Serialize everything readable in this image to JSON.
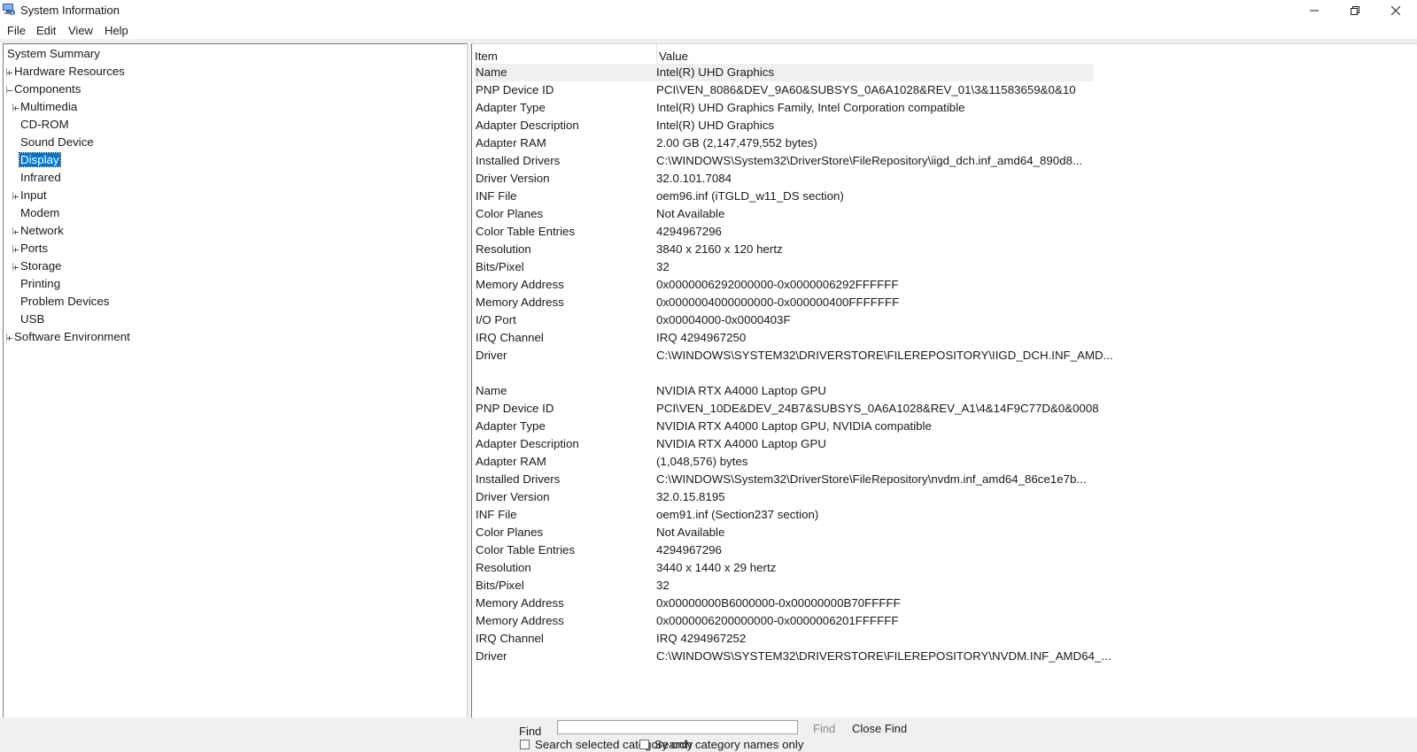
{
  "window": {
    "title": "System Information"
  },
  "menu": [
    "File",
    "Edit",
    "View",
    "Help"
  ],
  "tree": [
    {
      "label": "System Summary",
      "level": 0,
      "expander": "none"
    },
    {
      "label": "Hardware Resources",
      "level": 1,
      "expander": "plus"
    },
    {
      "label": "Components",
      "level": 1,
      "expander": "minus"
    },
    {
      "label": "Multimedia",
      "level": 2,
      "expander": "plus"
    },
    {
      "label": "CD-ROM",
      "level": 2,
      "expander": "none"
    },
    {
      "label": "Sound Device",
      "level": 2,
      "expander": "none"
    },
    {
      "label": "Display",
      "level": 2,
      "expander": "none",
      "selected": true
    },
    {
      "label": "Infrared",
      "level": 2,
      "expander": "none"
    },
    {
      "label": "Input",
      "level": 2,
      "expander": "plus"
    },
    {
      "label": "Modem",
      "level": 2,
      "expander": "none"
    },
    {
      "label": "Network",
      "level": 2,
      "expander": "plus"
    },
    {
      "label": "Ports",
      "level": 2,
      "expander": "plus"
    },
    {
      "label": "Storage",
      "level": 2,
      "expander": "plus"
    },
    {
      "label": "Printing",
      "level": 2,
      "expander": "none"
    },
    {
      "label": "Problem Devices",
      "level": 2,
      "expander": "none"
    },
    {
      "label": "USB",
      "level": 2,
      "expander": "none"
    },
    {
      "label": "Software Environment",
      "level": 1,
      "expander": "plus"
    }
  ],
  "list": {
    "columns": [
      "Item",
      "Value"
    ],
    "rows": [
      [
        "Name",
        "Intel(R) UHD Graphics"
      ],
      [
        "PNP Device ID",
        "PCI\\VEN_8086&DEV_9A60&SUBSYS_0A6A1028&REV_01\\3&11583659&0&10"
      ],
      [
        "Adapter Type",
        "Intel(R) UHD Graphics Family, Intel Corporation compatible"
      ],
      [
        "Adapter Description",
        "Intel(R) UHD Graphics"
      ],
      [
        "Adapter RAM",
        "2.00 GB (2,147,479,552 bytes)"
      ],
      [
        "Installed Drivers",
        "C:\\WINDOWS\\System32\\DriverStore\\FileRepository\\iigd_dch.inf_amd64_890d8..."
      ],
      [
        "Driver Version",
        "32.0.101.7084"
      ],
      [
        "INF File",
        "oem96.inf (iTGLD_w11_DS section)"
      ],
      [
        "Color Planes",
        "Not Available"
      ],
      [
        "Color Table Entries",
        "4294967296"
      ],
      [
        "Resolution",
        "3840 x 2160 x 120 hertz"
      ],
      [
        "Bits/Pixel",
        "32"
      ],
      [
        "Memory Address",
        "0x0000006292000000-0x0000006292FFFFFF"
      ],
      [
        "Memory Address",
        "0x0000004000000000-0x000000400FFFFFFF"
      ],
      [
        "I/O Port",
        "0x00004000-0x0000403F"
      ],
      [
        "IRQ Channel",
        "IRQ 4294967250"
      ],
      [
        "Driver",
        "C:\\WINDOWS\\SYSTEM32\\DRIVERSTORE\\FILEREPOSITORY\\IIGD_DCH.INF_AMD..."
      ],
      [
        "",
        ""
      ],
      [
        "Name",
        "NVIDIA RTX A4000 Laptop GPU"
      ],
      [
        "PNP Device ID",
        "PCI\\VEN_10DE&DEV_24B7&SUBSYS_0A6A1028&REV_A1\\4&14F9C77D&0&0008"
      ],
      [
        "Adapter Type",
        "NVIDIA RTX A4000 Laptop GPU, NVIDIA compatible"
      ],
      [
        "Adapter Description",
        "NVIDIA RTX A4000 Laptop GPU"
      ],
      [
        "Adapter RAM",
        "(1,048,576) bytes"
      ],
      [
        "Installed Drivers",
        "C:\\WINDOWS\\System32\\DriverStore\\FileRepository\\nvdm.inf_amd64_86ce1e7b..."
      ],
      [
        "Driver Version",
        "32.0.15.8195"
      ],
      [
        "INF File",
        "oem91.inf (Section237 section)"
      ],
      [
        "Color Planes",
        "Not Available"
      ],
      [
        "Color Table Entries",
        "4294967296"
      ],
      [
        "Resolution",
        "3440 x 1440 x 29 hertz"
      ],
      [
        "Bits/Pixel",
        "32"
      ],
      [
        "Memory Address",
        "0x00000000B6000000-0x00000000B70FFFFF"
      ],
      [
        "Memory Address",
        "0x0000006200000000-0x0000006201FFFFFF"
      ],
      [
        "IRQ Channel",
        "IRQ 4294967252"
      ],
      [
        "Driver",
        "C:\\WINDOWS\\SYSTEM32\\DRIVERSTORE\\FILEREPOSITORY\\NVDM.INF_AMD64_..."
      ]
    ]
  },
  "findbar": {
    "label": "Find",
    "input_value": "",
    "find_button": "Find",
    "close_button": "Close Find",
    "checkbox_selected": "Search selected category only",
    "checkbox_names": "Search category names only"
  },
  "colors": {
    "selection": "#0078d7",
    "chrome": "#f0f0f0"
  }
}
